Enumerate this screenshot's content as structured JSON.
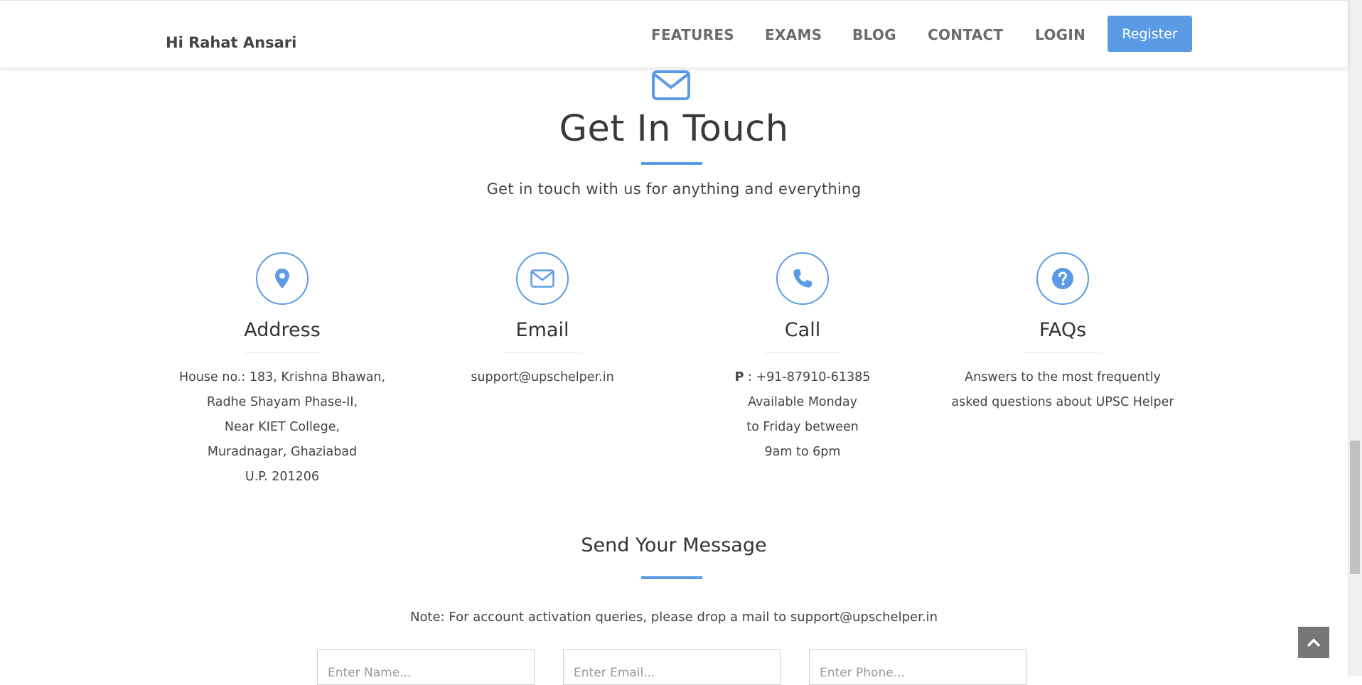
{
  "navbar": {
    "greeting": "Hi Rahat Ansari",
    "links": [
      "FEATURES",
      "EXAMS",
      "BLOG",
      "CONTACT",
      "LOGIN"
    ],
    "register_label": "Register",
    "accent_color": "#5b9be6"
  },
  "header": {
    "icon": "envelope-icon",
    "title": "Get In Touch",
    "subtitle": "Get in touch with us for anything and everything"
  },
  "columns": [
    {
      "icon": "map-marker-icon",
      "title": "Address",
      "lines": [
        "House no.: 183, Krishna Bhawan,",
        "Radhe Shayam Phase-II,",
        "Near KIET College,",
        "Muradnagar, Ghaziabad",
        "U.P. 201206"
      ]
    },
    {
      "icon": "envelope-icon",
      "title": "Email",
      "lines": [
        "support@upschelper.in"
      ]
    },
    {
      "icon": "phone-icon",
      "title": "Call",
      "phone_label": "P",
      "phone_value": " : +91-87910-61385",
      "lines": [
        "Available Monday",
        "to Friday between",
        "9am to 6pm"
      ]
    },
    {
      "icon": "question-circle-icon",
      "title": "FAQs",
      "lines": [
        "Answers to the most frequently",
        "asked questions about UPSC Helper"
      ]
    }
  ],
  "message": {
    "title": "Send Your Message",
    "note": "Note: For account activation queries, please drop a mail to support@upschelper.in",
    "name_placeholder": "Enter Name...",
    "email_placeholder": "Enter Email...",
    "phone_placeholder": "Enter Phone..."
  },
  "back_to_top_icon": "chevron-up-icon"
}
